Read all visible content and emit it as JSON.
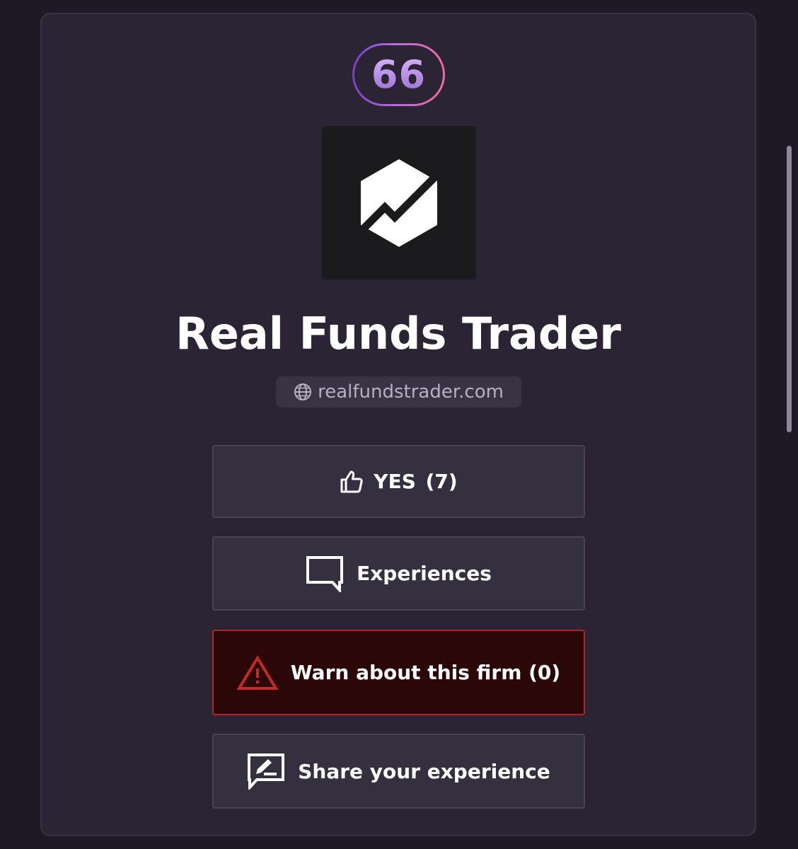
{
  "firm": {
    "score": "66",
    "name": "Real Funds Trader",
    "website": "realfundstrader.com"
  },
  "actions": {
    "yes_label": "YES",
    "yes_count": "(7)",
    "experiences_label": "Experiences",
    "warn_label": "Warn about this firm (0)",
    "share_label": "Share your experience"
  },
  "colors": {
    "warn_border": "#b3231f",
    "warn_background": "#2b0707",
    "badge_gradient_start": "#7a3fc4",
    "badge_gradient_end": "#f06a9a"
  },
  "icons": {
    "website": "globe-icon",
    "yes": "thumbs-up-icon",
    "experiences": "chat-bubble-icon",
    "warn": "warning-triangle-icon",
    "share": "edit-message-icon"
  }
}
